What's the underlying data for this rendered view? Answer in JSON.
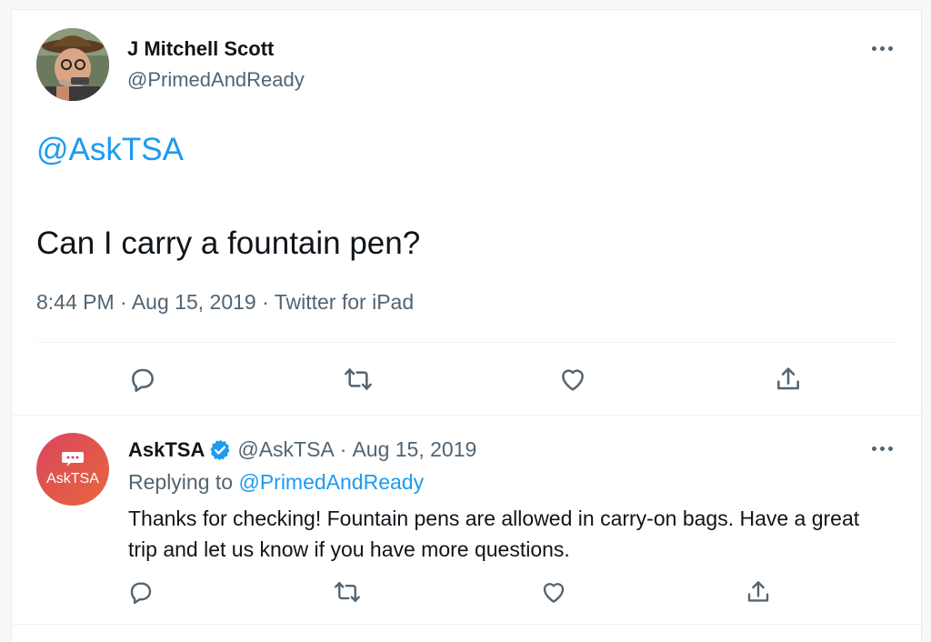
{
  "tweet": {
    "author_name": "J Mitchell Scott",
    "author_handle": "@PrimedAndReady",
    "mention": "@AskTSA",
    "text": "Can I carry a fountain pen?",
    "time": "8:44 PM",
    "date": "Aug 15, 2019",
    "source": "Twitter for iPad",
    "separator": "·",
    "actions": {
      "reply_icon": "reply-icon",
      "retweet_icon": "retweet-icon",
      "like_icon": "like-icon",
      "share_icon": "share-icon"
    }
  },
  "reply": {
    "author_name": "AskTSA",
    "verified": true,
    "author_handle": "@AskTSA",
    "separator": "·",
    "date": "Aug 15, 2019",
    "replying_prefix": "Replying to",
    "replying_to": "@PrimedAndReady",
    "text": "Thanks for checking! Fountain pens are allowed in carry-on bags. Have a great trip and let us know if you have more questions.",
    "avatar_label": "AskTSA"
  },
  "colors": {
    "accent": "#1d9bf0",
    "muted": "#536471",
    "avatar_gradient_start": "#d9455f",
    "avatar_gradient_end": "#e8673c"
  }
}
